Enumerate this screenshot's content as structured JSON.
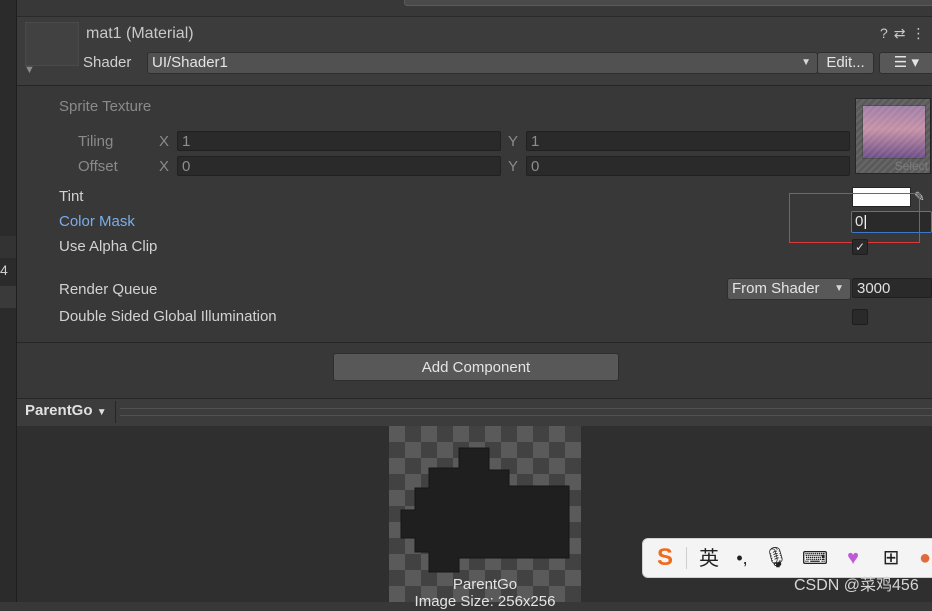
{
  "material": {
    "title": "mat1 (Material)",
    "shader_label": "Shader",
    "shader_value": "UI/Shader1",
    "edit_label": "Edit...",
    "header_icons": [
      "help-icon",
      "preset-icon",
      "more-icon"
    ]
  },
  "properties": {
    "sprite_texture": "Sprite Texture",
    "tiling": {
      "label": "Tiling",
      "x_axis": "X",
      "x": "1",
      "y_axis": "Y",
      "y": "1"
    },
    "offset": {
      "label": "Offset",
      "x_axis": "X",
      "x": "0",
      "y_axis": "Y",
      "y": "0"
    },
    "texture_select": "Select",
    "tint": {
      "label": "Tint",
      "color": "#ffffff"
    },
    "color_mask": {
      "label": "Color Mask",
      "value": "0"
    },
    "use_alpha_clip": {
      "label": "Use Alpha Clip",
      "checked": true
    },
    "render_queue": {
      "label": "Render Queue",
      "mode": "From Shader",
      "value": "3000"
    },
    "double_sided_gi": {
      "label": "Double Sided Global Illumination",
      "checked": false
    }
  },
  "add_component_label": "Add Component",
  "preview": {
    "object_dropdown": "ParentGo",
    "name": "ParentGo",
    "size": "Image Size: 256x256"
  },
  "left_panel": {
    "number": "4"
  },
  "ime_toolbar": {
    "items": [
      "sogou-logo-icon",
      "英",
      "punctuation-icon",
      "microphone-icon",
      "keyboard-icon",
      "skin-icon",
      "apps-icon",
      "avatar-icon"
    ],
    "lang_label": "英"
  },
  "watermark": "CSDN @菜鸡456",
  "colors": {
    "panel": "#383838",
    "accent_blue": "#7baee8",
    "highlight_red": "#d93a3a"
  }
}
